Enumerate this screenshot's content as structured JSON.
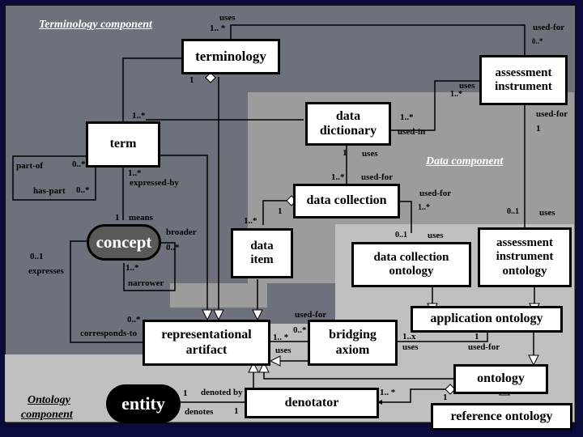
{
  "components": {
    "terminology": "Terminology component",
    "data": "Data component",
    "ontology_line1": "Ontology",
    "ontology_line2": "component"
  },
  "classes": {
    "terminology": "terminology",
    "assessment_instrument_1": "assessment",
    "assessment_instrument_2": "instrument",
    "term": "term",
    "data_dictionary_1": "data",
    "data_dictionary_2": "dictionary",
    "data_collection": "data collection",
    "concept": "concept",
    "data_item_1": "data",
    "data_item_2": "item",
    "data_collection_ontology_1": "data collection",
    "data_collection_ontology_2": "ontology",
    "assessment_instrument_ontology_1": "assessment",
    "assessment_instrument_ontology_2": "instrument",
    "assessment_instrument_ontology_3": "ontology",
    "representational_artifact_1": "representational",
    "representational_artifact_2": "artifact",
    "bridging_axiom_1": "bridging",
    "bridging_axiom_2": "axiom",
    "application_ontology": "application ontology",
    "ontology": "ontology",
    "entity": "entity",
    "denotator": "denotator",
    "reference_ontology": "reference ontology"
  },
  "labels": {
    "uses_top": "uses",
    "mult_1star_top": "1.. *",
    "used_for_top": "used-for",
    "mult_0star_top": "0..*",
    "mult_1_terminology": "1",
    "uses_ai": "uses",
    "mult_1star_ai": "1..*",
    "mult_1star_term": "1..*",
    "mult_1star_dd": "1..*",
    "used_in": "used-in",
    "used_for_ai": "used-for",
    "mult_1_ai": "1",
    "part_of": "part-of",
    "mult_0star_partof": "0..*",
    "has_part": "has-part",
    "mult_0star_haspart": "0..*",
    "mult_1star_expr": "1..*",
    "expressed_by": "expressed-by",
    "mult_1_dd": "1",
    "uses_dd": "uses",
    "mult_1star_dc": "1..*",
    "used_for_dc": "used-for",
    "used_for_dc2": "used-for",
    "mult_1star_dc2": "1..*",
    "mult_01_ai": "0..1",
    "uses_aio": "uses",
    "mult_1_dc": "1",
    "mult_1star_di": "1..*",
    "mult_1_means": "1",
    "means": "means",
    "broader": "broader",
    "mult_0star_broader": "0..*",
    "mult_01_expresses": "0..1",
    "expresses": "expresses",
    "mult_1star_narrower": "1..*",
    "narrower": "narrower",
    "mult_01_dco": "0..1",
    "uses_dco": "uses",
    "mult_0star_corr": "0..*",
    "corresponds_to": "corresponds-to",
    "used_for_ba": "used-for",
    "mult_0star_ba": "0..*",
    "mult_1star_ra": "1.. *",
    "uses_ra": "uses",
    "mult_1x_ao": "1..x",
    "uses_ao": "uses",
    "mult_1_ao": "1",
    "used_for_ao": "used-for",
    "mult_1_entity": "1",
    "denoted_by": "denoted by",
    "denotes": "denotes",
    "mult_1_denotes": "1",
    "mult_1star_den": "1.. *",
    "mult_1_onto": "1"
  }
}
